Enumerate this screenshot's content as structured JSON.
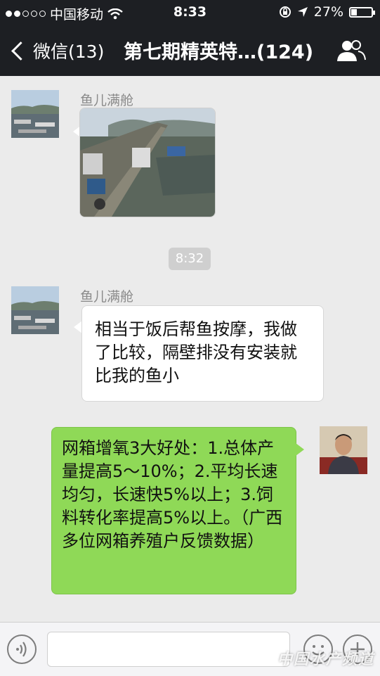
{
  "status_bar": {
    "carrier": "中国移动",
    "time": "8:33",
    "battery_pct": "27%",
    "battery_level": 0.27,
    "signal_bars_filled": 2,
    "signal_bars_total": 5
  },
  "nav": {
    "back_label": "微信(13)",
    "title": "第七期精英特…(124)",
    "right_icon": "group-members-icon"
  },
  "messages": [
    {
      "sender": "鱼儿满舱",
      "type": "image",
      "side": "left"
    },
    {
      "timestamp": "8:32"
    },
    {
      "sender": "鱼儿满舱",
      "type": "text",
      "side": "left",
      "text": "相当于饭后帮鱼按摩，我做了比较，隔壁排没有安装就比我的鱼小"
    },
    {
      "sender": "",
      "type": "text",
      "side": "right",
      "text": "网箱增氧3大好处：1.总体产量提高5～10%；2.平均长速均匀，长速快5%以上；3.饲料转化率提高5%以上。（广西多位网箱养殖户反馈数据）"
    }
  ],
  "input": {
    "placeholder": "",
    "voice_icon": "voice-icon",
    "emoji_icon": "emoji-icon",
    "plus_icon": "plus-icon"
  },
  "watermark": "中国水产频道",
  "colors": {
    "bar_bg": "#1d1f23",
    "chat_bg": "#ebebeb",
    "green_bubble": "#8fd957"
  }
}
